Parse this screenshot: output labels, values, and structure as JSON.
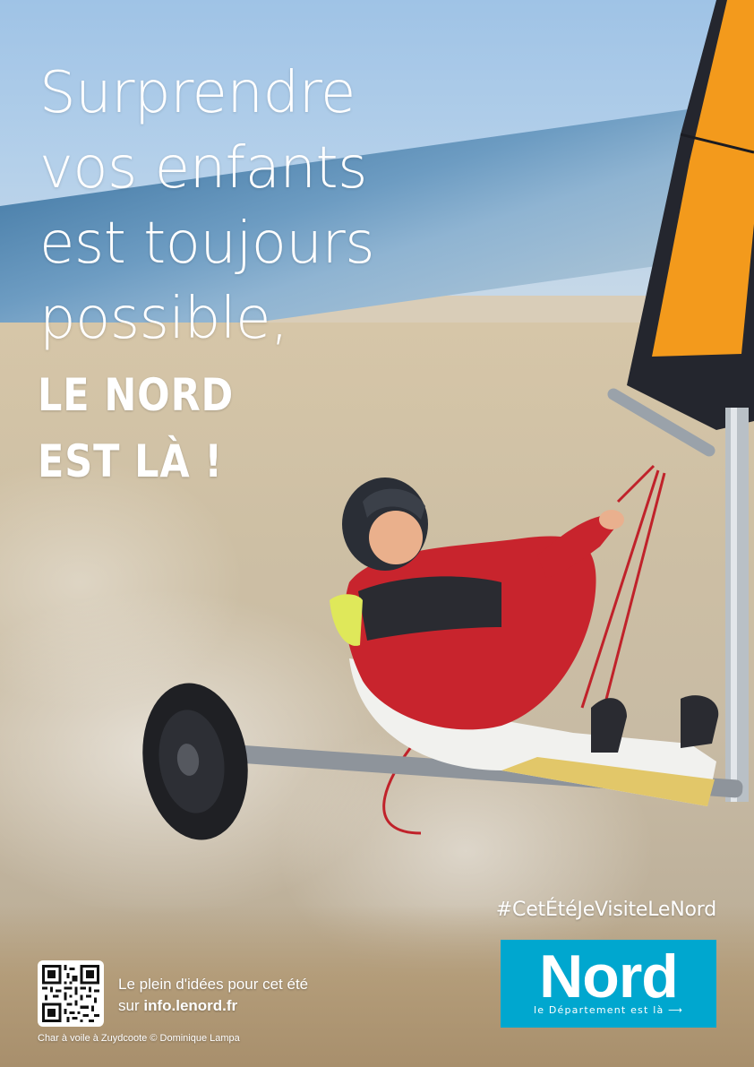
{
  "headline": {
    "lines": [
      "Surprendre",
      "vos enfants",
      "est toujours",
      "possible,"
    ]
  },
  "tagline": {
    "lines": [
      "LE NORD",
      "EST LÀ !"
    ]
  },
  "hashtag": "#CetÉtéJeVisiteLeNord",
  "logo": {
    "word": "Nord",
    "subtitle": "le Département est là ⟶",
    "color": "#00a7cf"
  },
  "info": {
    "line1": "Le plein d'idées pour cet été",
    "prefix": "sur ",
    "url": "info.lenord.fr"
  },
  "photo_credit": "Char à voile à Zuydcoote © Dominique Lampa",
  "icons": {
    "qr": "qr-code-icon"
  },
  "colors": {
    "text": "#ffffff",
    "sail_orange": "#f39a1c",
    "sail_dark": "#24262e",
    "jacket_red": "#c8242d"
  }
}
